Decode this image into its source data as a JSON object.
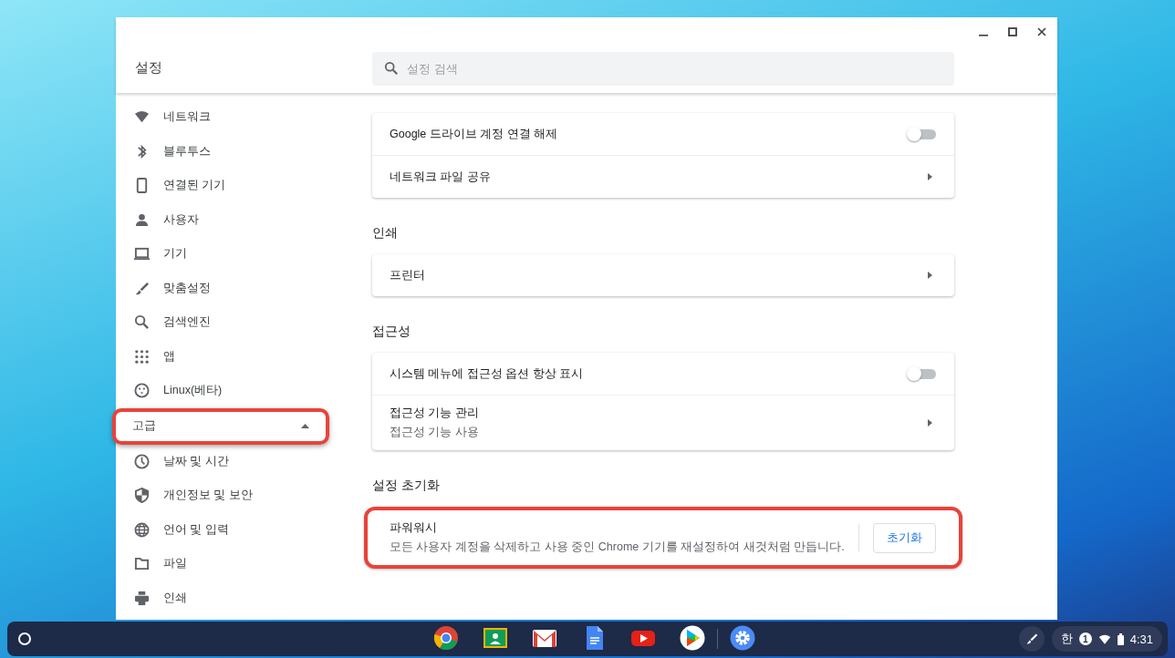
{
  "window": {
    "title": "설정"
  },
  "search": {
    "placeholder": "설정 검색"
  },
  "sidebar": {
    "items": [
      {
        "kind": "item",
        "label": "네트워크"
      },
      {
        "kind": "item",
        "label": "블루투스"
      },
      {
        "kind": "item",
        "label": "연결된 기기"
      },
      {
        "kind": "item",
        "label": "사용자"
      },
      {
        "kind": "item",
        "label": "기기"
      },
      {
        "kind": "item",
        "label": "맞춤설정"
      },
      {
        "kind": "item",
        "label": "검색엔진"
      },
      {
        "kind": "item",
        "label": "앱"
      },
      {
        "kind": "item",
        "label": "Linux(베타)"
      },
      {
        "kind": "section",
        "label": "고급",
        "expanded": true,
        "highlighted": true
      },
      {
        "kind": "item",
        "label": "날짜 및 시간"
      },
      {
        "kind": "item",
        "label": "개인정보 및 보안"
      },
      {
        "kind": "item",
        "label": "언어 및 입력"
      },
      {
        "kind": "item",
        "label": "파일"
      },
      {
        "kind": "item",
        "label": "인쇄"
      }
    ]
  },
  "sections": [
    {
      "rows": [
        {
          "kind": "toggle",
          "title": "Google 드라이브 계정 연결 해제",
          "on": false
        },
        {
          "kind": "link",
          "title": "네트워크 파일 공유"
        }
      ]
    },
    {
      "heading": "인쇄",
      "rows": [
        {
          "kind": "link",
          "title": "프린터"
        }
      ]
    },
    {
      "heading": "접근성",
      "rows": [
        {
          "kind": "toggle",
          "title": "시스템 메뉴에 접근성 옵션 항상 표시",
          "on": false
        },
        {
          "kind": "link",
          "title": "접근성 기능 관리",
          "subtitle": "접근성 기능 사용"
        }
      ]
    },
    {
      "heading": "설정 초기화",
      "highlighted": true,
      "rows": [
        {
          "kind": "button",
          "title": "파워워시",
          "subtitle": "모든 사용자 계정을 삭제하고 사용 중인 Chrome 기기를 재설정하여 새것처럼 만듭니다.",
          "button": "초기화"
        }
      ]
    }
  ],
  "status_tray": {
    "input_method": "한",
    "notification_count": "1",
    "time": "4:31"
  }
}
